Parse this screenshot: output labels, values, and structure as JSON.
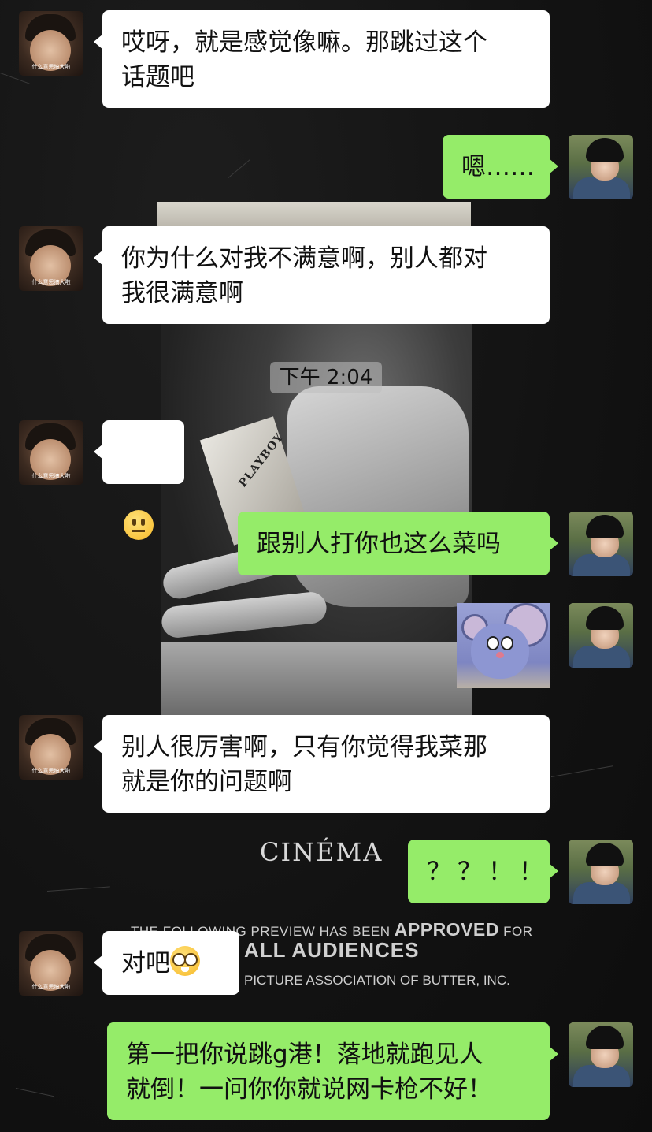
{
  "messages": [
    {
      "side": "left",
      "text": "哎呀，就是感觉像嘛。那跳过这个\n话题吧"
    },
    {
      "side": "right",
      "text": "嗯……"
    },
    {
      "side": "left",
      "text": "你为什么对我不满意啊，别人都对\n我很满意啊"
    },
    {
      "side": "left",
      "emoji": "neutral-face-emoji"
    },
    {
      "side": "right",
      "text": "跟别人打你也这么菜吗"
    },
    {
      "side": "right",
      "sticker": "jerry-mouse-sticker"
    },
    {
      "side": "left",
      "text": "别人很厉害啊，只有你觉得我菜那\n就是你的问题啊"
    },
    {
      "side": "right",
      "text": "？？！！"
    },
    {
      "side": "left",
      "text": "对吧",
      "emoji": "nerd-face-emoji"
    },
    {
      "side": "right",
      "text": "第一把你说跳g港！落地就跑见人\n就倒！一问你你就说网卡枪不好！"
    }
  ],
  "timestamp": "下午 2:04",
  "avatars": {
    "left_caption": "什么意思搞大啦"
  },
  "background": {
    "magazine": "PLAYBOY",
    "cinema": "CINÉMA",
    "approved_pre": "THE FOLLOWING PREVIEW HAS BEEN ",
    "approved_big": "APPROVED",
    "approved_post": " FOR",
    "audiences": "ALL AUDIENCES",
    "association": "PICTURE ASSOCIATION OF BUTTER, INC."
  },
  "colors": {
    "page_background": "#141414",
    "bubble_white": "#ffffff",
    "bubble_green": "#95ec69"
  }
}
